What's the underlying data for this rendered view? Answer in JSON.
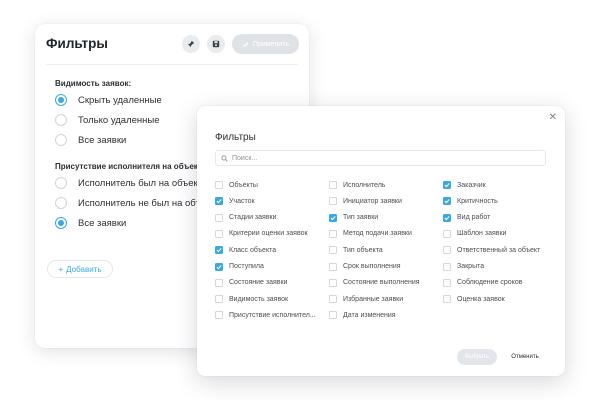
{
  "back_panel": {
    "title": "Фильтры",
    "apply_label": "Применить",
    "icons": [
      "pin-icon",
      "save-icon",
      "check-icon"
    ],
    "visibility": {
      "label": "Видимость заявок:",
      "options": [
        {
          "label": "Скрыть удаленные",
          "selected": true
        },
        {
          "label": "Только удаленные",
          "selected": false
        },
        {
          "label": "Все заявки",
          "selected": false
        }
      ]
    },
    "executor": {
      "label": "Присутствие исполнителя на объекте",
      "options": [
        {
          "label": "Исполнитель был на объекте",
          "selected": false
        },
        {
          "label": "Исполнитель не был на объекте",
          "selected": false
        },
        {
          "label": "Все заявки",
          "selected": true
        }
      ]
    },
    "add_label": "Добавить"
  },
  "modal": {
    "title": "Фильтры",
    "search_placeholder": "Поиск...",
    "columns": [
      [
        {
          "label": "Объекты",
          "checked": false
        },
        {
          "label": "Участок",
          "checked": true
        },
        {
          "label": "Стадии заявки",
          "checked": false
        },
        {
          "label": "Критерии оценки заявок",
          "checked": false
        },
        {
          "label": "Класс объекта",
          "checked": true
        },
        {
          "label": "Поступила",
          "checked": true
        },
        {
          "label": "Состояние заявки",
          "checked": false
        },
        {
          "label": "Видимость заявок",
          "checked": false
        },
        {
          "label": "Присутствие исполнител...",
          "checked": false
        }
      ],
      [
        {
          "label": "Исполнитель",
          "checked": false
        },
        {
          "label": "Инициатор заявки",
          "checked": false
        },
        {
          "label": "Тип заявки",
          "checked": true
        },
        {
          "label": "Метод подачи заявки",
          "checked": false
        },
        {
          "label": "Тип объекта",
          "checked": false
        },
        {
          "label": "Срок выполнения",
          "checked": false
        },
        {
          "label": "Состояние выполнения",
          "checked": false
        },
        {
          "label": "Избранные заявки",
          "checked": false
        },
        {
          "label": "Дата изменения",
          "checked": false
        }
      ],
      [
        {
          "label": "Заказчик",
          "checked": true
        },
        {
          "label": "Критичность",
          "checked": true
        },
        {
          "label": "Вид работ",
          "checked": true
        },
        {
          "label": "Шаблон заявки",
          "checked": false
        },
        {
          "label": "Ответственный за объект",
          "checked": false
        },
        {
          "label": "Закрыта",
          "checked": false
        },
        {
          "label": "Соблюдение сроков",
          "checked": false
        },
        {
          "label": "Оценка заявок",
          "checked": false
        }
      ]
    ],
    "select_label": "Выбрать",
    "cancel_label": "Отменить"
  },
  "colors": {
    "accent": "#3aa9df",
    "disabled_button": "#dfe3e7",
    "text": "#2b2f33"
  }
}
